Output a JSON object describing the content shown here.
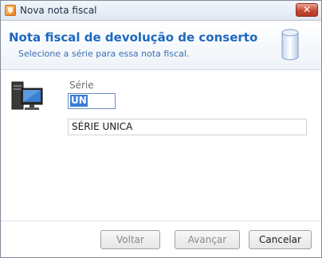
{
  "window": {
    "title": "Nova nota fiscal",
    "close_glyph": "✕"
  },
  "header": {
    "title": "Nota fiscal de devolução de conserto",
    "subtitle": "Selecione a série para essa nota fiscal."
  },
  "form": {
    "serie_label": "Série",
    "serie_value": "UN",
    "serie_description": "SÉRIE UNICA"
  },
  "buttons": {
    "back": "Voltar",
    "next": "Avançar",
    "cancel": "Cancelar"
  },
  "icons": [
    "app-icon",
    "close-icon",
    "database-icon",
    "computer-icon"
  ]
}
